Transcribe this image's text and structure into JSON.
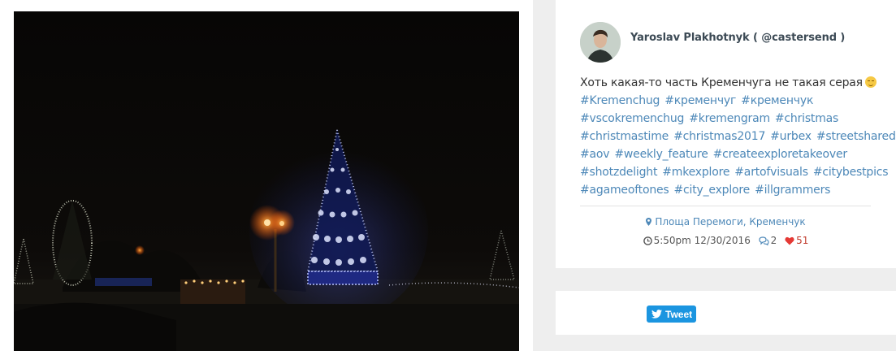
{
  "post": {
    "author": "Yaroslav Plakhotnyk ( @castersend )",
    "caption": "Хоть какая-то часть Кременчуга не такая серая",
    "hashtags": [
      "#Kremenchug",
      "#кременчуг",
      "#кременчук",
      "#vscokremenchug",
      "#kremengram",
      "#christmas",
      "#christmastime",
      "#christmas2017",
      "#urbex",
      "#streetshared",
      "#aov",
      "#weekly_feature",
      "#createexploretakeover",
      "#shotzdelight",
      "#mkexplore",
      "#artofvisuals",
      "#citybestpics",
      "#agameoftones",
      "#city_explore",
      "#illgrammers"
    ],
    "location": "Площа Перемоги, Кременчук",
    "datetime": "5:50pm 12/30/2016",
    "comments": "2",
    "likes": "51"
  },
  "share": {
    "tweet_label": "Tweet"
  },
  "icons": {
    "pin": "map-marker-icon",
    "clock": "clock-icon",
    "comments": "comments-icon",
    "heart": "heart-icon",
    "twitter": "twitter-bird-icon"
  },
  "colors": {
    "link": "#4d88b8",
    "heart": "#e53935",
    "tweet": "#1b95e0"
  }
}
